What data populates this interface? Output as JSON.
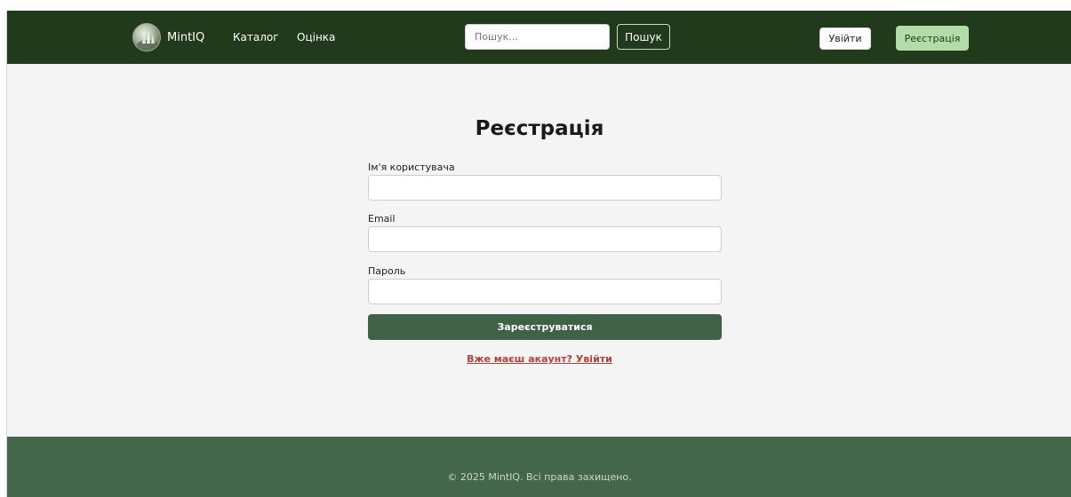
{
  "header": {
    "brand": "MintIQ",
    "nav": [
      {
        "label": "Каталог"
      },
      {
        "label": "Оцінка"
      }
    ],
    "search": {
      "placeholder": "Пошук...",
      "value": "",
      "button_label": "Пошук"
    },
    "login_label": "Увійти",
    "register_label": "Реєстрація"
  },
  "form": {
    "title": "Реєстрація",
    "fields": [
      {
        "label": "Ім'я користувача",
        "value": ""
      },
      {
        "label": "Email",
        "value": ""
      },
      {
        "label": "Пароль",
        "value": ""
      }
    ],
    "submit_label": "Зареєструватися",
    "login_link": "Вже маєш акаунт? Увійти"
  },
  "footer": {
    "text": "© 2025 MintIQ. Всі права захищено."
  },
  "colors": {
    "header_bg": "#213a1b",
    "footer_bg": "#44664b",
    "primary_button": "#3f6145",
    "register_button": "#b4dca9",
    "link": "#b5413a",
    "page_bg": "#f4f4f4"
  },
  "icons": {
    "logo": "logo-avatar-icon"
  }
}
